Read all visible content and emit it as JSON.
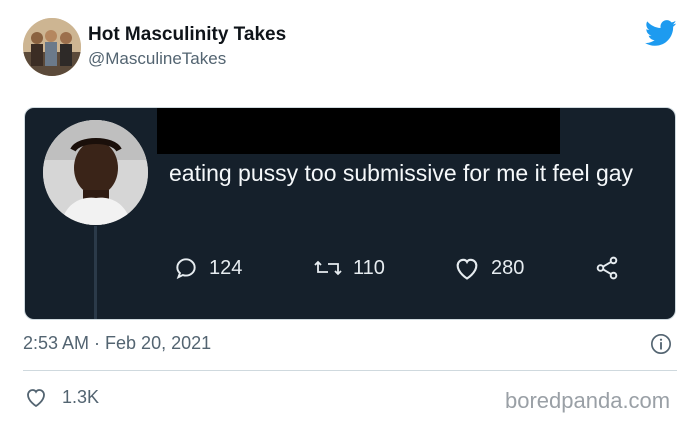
{
  "header": {
    "display_name": "Hot Masculinity Takes",
    "handle": "@MasculineTakes",
    "avatar_icon": "group-photo-avatar",
    "brand_icon": "twitter-bird-icon",
    "brand_color": "#1d9bf0"
  },
  "embedded_tweet": {
    "text": "eating pussy too submissive for me it feel gay",
    "counts": {
      "replies": "124",
      "retweets": "110",
      "likes": "280"
    },
    "background_color": "#15202b",
    "redaction": "black-box-over-username"
  },
  "footer": {
    "timestamp": "2:53 AM · Feb 20, 2021",
    "like_count": "1.3K",
    "info_icon": "info-icon"
  },
  "watermark": "boredpanda.com"
}
